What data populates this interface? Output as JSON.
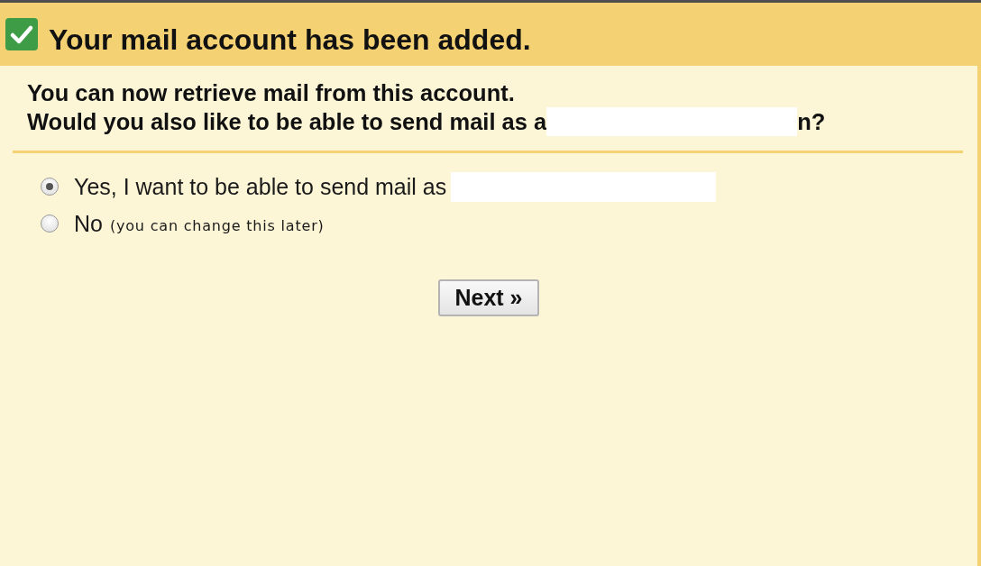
{
  "header": {
    "title": "Your mail account has been added."
  },
  "message": {
    "line_1": "You can now retrieve mail from this account.",
    "line_2_before": "Would you also like to be able to send mail as a",
    "line_2_redacted": true,
    "line_2_after": "n?"
  },
  "options": [
    {
      "label": "Yes, I want to be able to send mail as",
      "redacted": true,
      "selected": true
    },
    {
      "label": "No",
      "note": "(you can change this later)",
      "selected": false
    }
  ],
  "buttons": [
    {
      "label": "Next »"
    }
  ]
}
